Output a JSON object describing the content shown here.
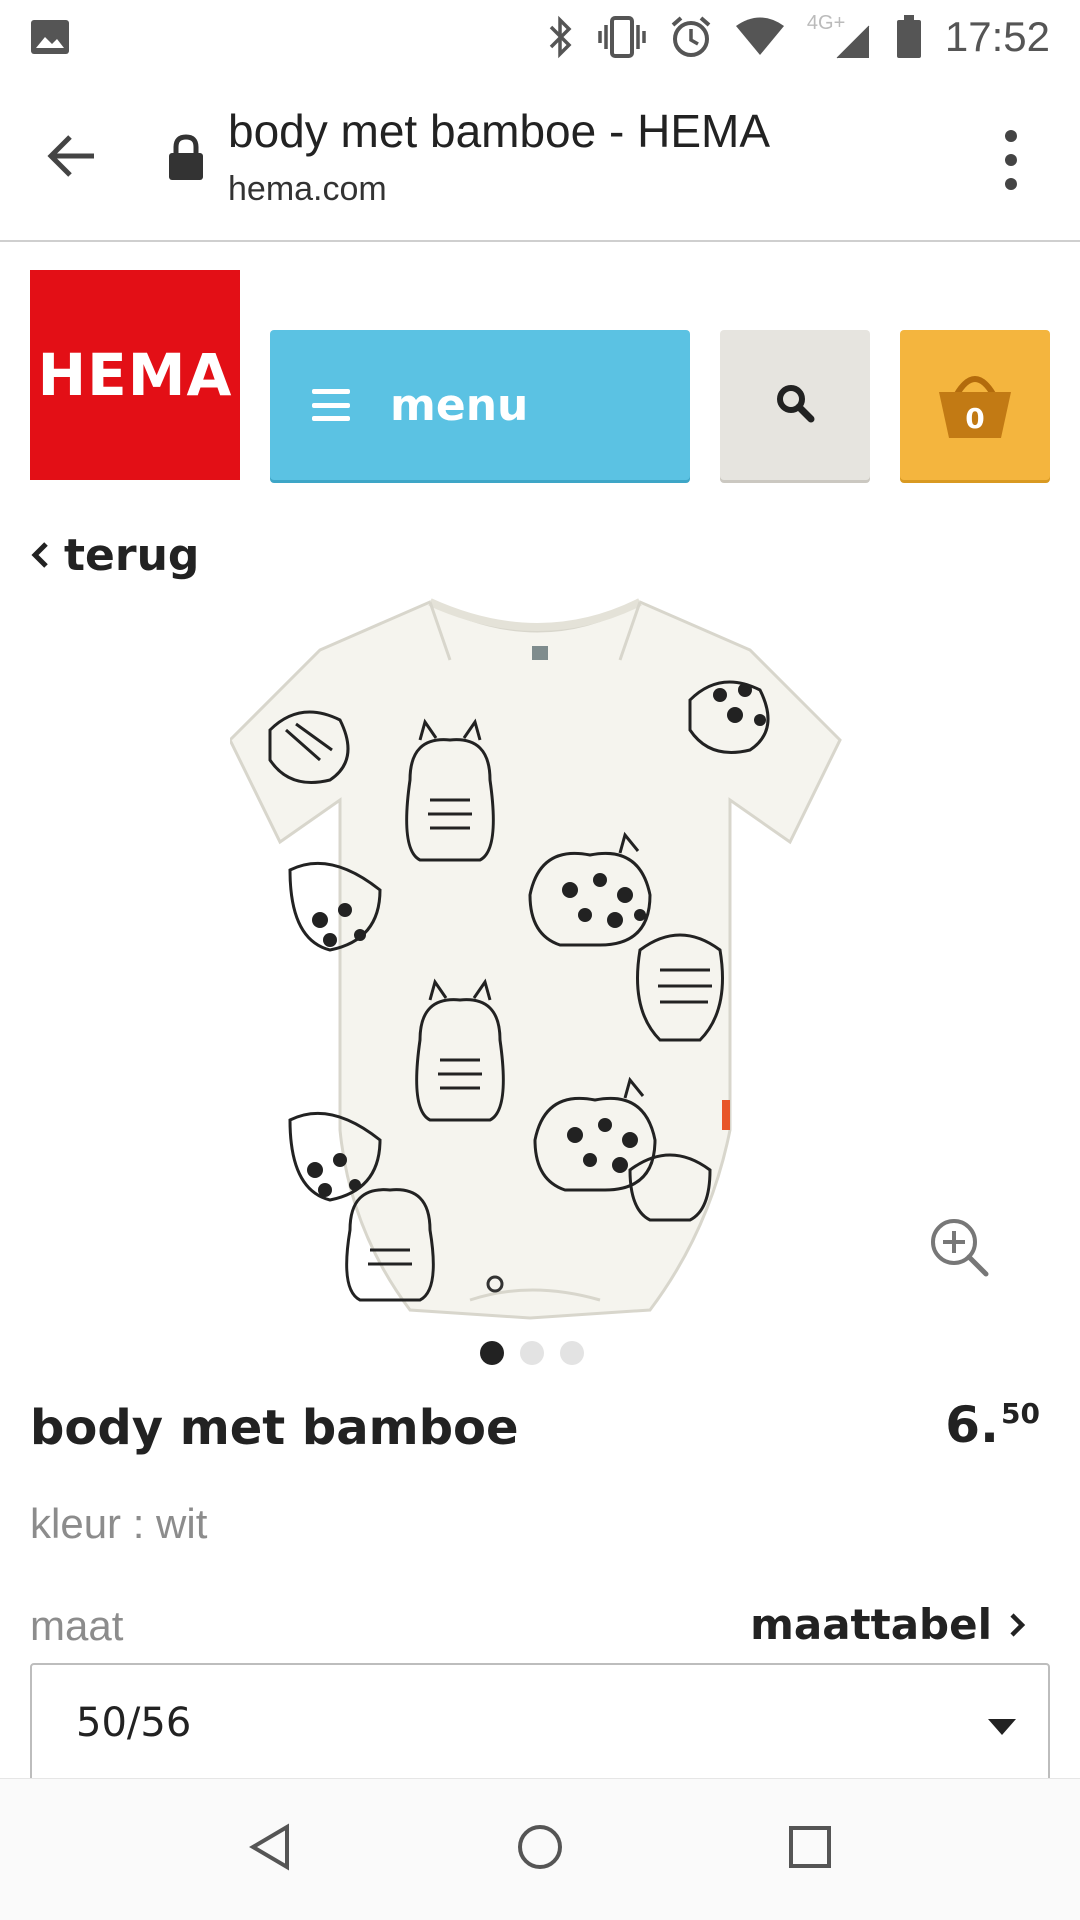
{
  "status_bar": {
    "time": "17:52",
    "network_type": "4G+",
    "icons": [
      "gallery-icon",
      "bluetooth-icon",
      "vibrate-icon",
      "alarm-icon",
      "wifi-icon",
      "signal-icon",
      "battery-icon"
    ]
  },
  "browser": {
    "page_title": "body met bamboe - HEMA",
    "url": "hema.com"
  },
  "header": {
    "logo_text": "HEMA",
    "menu_label": "menu",
    "cart_count": "0",
    "colors": {
      "logo_red": "#e30f16",
      "menu_blue": "#5bc2e3",
      "search_grey": "#e6e4df",
      "cart_yellow": "#f4b53e"
    }
  },
  "back_link": {
    "label": "terug"
  },
  "carousel": {
    "image_count": 3,
    "active_index": 0
  },
  "product": {
    "name": "body met bamboe",
    "price_whole": "6",
    "price_separator": ".",
    "price_cents": "50",
    "color_line": "kleur : wit",
    "size_label": "maat",
    "size_chart_label": "maattabel",
    "selected_size": "50/56"
  }
}
